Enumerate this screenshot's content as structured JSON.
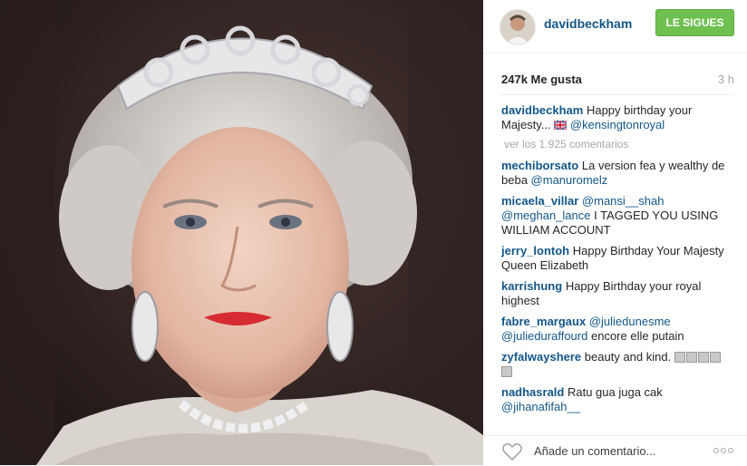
{
  "post": {
    "username": "davidbeckham",
    "follow_label": "LE SIGUES",
    "likes": "247k Me gusta",
    "time": "3 h",
    "view_all": "ver los 1.925 comentarios",
    "add_comment_placeholder": "Añade un comentario...",
    "caption": {
      "user": "davidbeckham",
      "text": "Happy birthday your Majesty...",
      "mention": "@kensingtonroyal"
    }
  },
  "comments": [
    {
      "user": "mechiborsato",
      "text": "La version fea y wealthy de beba",
      "mention": "@manuromelz"
    },
    {
      "user": "micaela_villar",
      "mention1": "@mansi__shah",
      "mention2": "@meghan_lance",
      "text": "I TAGGED YOU USING WILLIAM ACCOUNT"
    },
    {
      "user": "jerry_lontoh",
      "text": "Happy Birthday Your Majesty Queen Elizabeth"
    },
    {
      "user": "karrishung",
      "text": "Happy Birthday your royal highest"
    },
    {
      "user": "fabre_margaux",
      "mention1": "@juliedunesme",
      "mention2": "@julieduraffourd",
      "text": "encore elle putain"
    },
    {
      "user": "zyfalwayshere",
      "text": "beauty and kind."
    },
    {
      "user": "nadhasrald",
      "text": "Ratu gua juga cak",
      "mention": "@jihanafifah__"
    }
  ],
  "icons": {
    "heart": "heart-icon",
    "more": "more-options-icon",
    "flag": "uk-flag-emoji"
  },
  "colors": {
    "username": "#125688",
    "follow_button": "#70c050",
    "muted": "#a5a7aa"
  }
}
